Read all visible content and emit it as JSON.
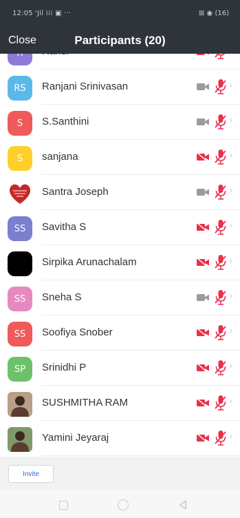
{
  "status_bar": {
    "left": "12:05 'Jil ⁞⁞⁞ ▣ ···",
    "right": "⊞ ◉ (16)"
  },
  "header": {
    "close_label": "Close",
    "title": "Participants (20)"
  },
  "participants": [
    {
      "name": "Rahul",
      "initials": "R",
      "avatar_color": "#8c7bd8",
      "avatar_type": "initials",
      "video": "off",
      "audio": "muted"
    },
    {
      "name": "Ranjani Srinivasan",
      "initials": "RS",
      "avatar_color": "#5bb9ea",
      "avatar_type": "initials",
      "video": "on",
      "audio": "muted"
    },
    {
      "name": "S.Santhini",
      "initials": "S",
      "avatar_color": "#ef5a5a",
      "avatar_type": "initials",
      "video": "on",
      "audio": "muted"
    },
    {
      "name": "sanjana",
      "initials": "S",
      "avatar_color": "#ffd02a",
      "avatar_type": "initials",
      "video": "off",
      "audio": "muted"
    },
    {
      "name": "Santra Joseph",
      "initials": "",
      "avatar_color": "#c62828",
      "avatar_type": "heart-image",
      "video": "on",
      "audio": "muted"
    },
    {
      "name": "Savitha S",
      "initials": "SS",
      "avatar_color": "#7b7fcf",
      "avatar_type": "initials",
      "video": "off",
      "audio": "muted"
    },
    {
      "name": "Sirpika Arunachalam",
      "initials": "",
      "avatar_color": "#000000",
      "avatar_type": "solid",
      "video": "off",
      "audio": "muted"
    },
    {
      "name": "Sneha S",
      "initials": "SS",
      "avatar_color": "#e58ac0",
      "avatar_type": "initials",
      "video": "on",
      "audio": "muted"
    },
    {
      "name": "Soofiya Snober",
      "initials": "SS",
      "avatar_color": "#ef5a5a",
      "avatar_type": "initials",
      "video": "off",
      "audio": "muted"
    },
    {
      "name": "Srinidhi P",
      "initials": "SP",
      "avatar_color": "#6cc26a",
      "avatar_type": "initials",
      "video": "off",
      "audio": "muted"
    },
    {
      "name": "SUSHMITHA RAM",
      "initials": "",
      "avatar_color": "#b89f86",
      "avatar_type": "photo",
      "video": "off",
      "audio": "muted"
    },
    {
      "name": "Yamini Jeyaraj",
      "initials": "",
      "avatar_color": "#7f9a6a",
      "avatar_type": "photo",
      "video": "off",
      "audio": "muted"
    }
  ],
  "footer": {
    "invite_label": "Invite"
  },
  "icons": {
    "camera_on": "video-camera-icon",
    "camera_off": "video-camera-off-icon",
    "mic_muted": "microphone-muted-icon",
    "chevron": "chevron-right-icon"
  },
  "colors": {
    "header_bg": "#2f343b",
    "muted_red": "#e8314a",
    "camera_gray": "#9b9b9b",
    "invite_blue": "#3a6ad3"
  }
}
